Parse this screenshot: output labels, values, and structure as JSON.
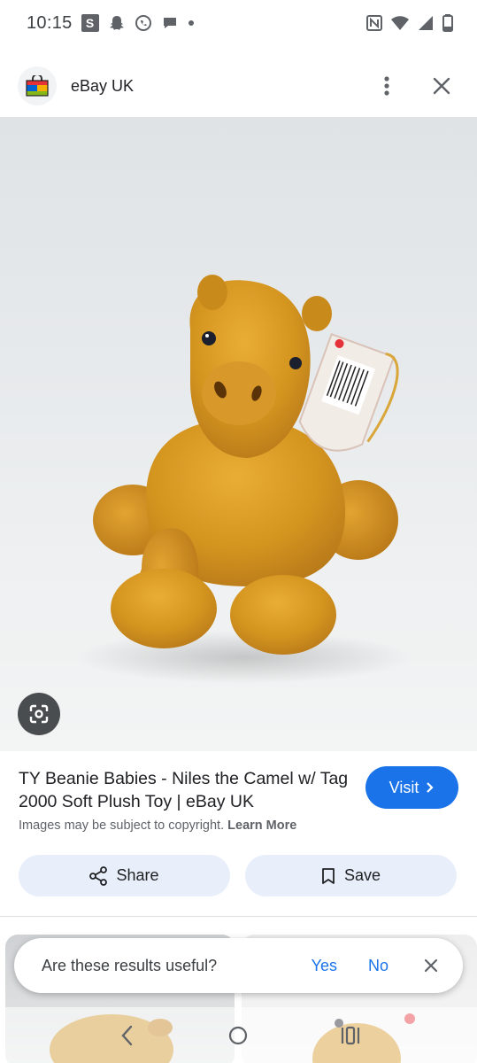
{
  "status_bar": {
    "time": "10:15",
    "s_badge": "S",
    "icons": [
      "snapchat-icon",
      "whatsapp-icon",
      "chat-bubble-icon",
      "dot-icon",
      "nfc-icon",
      "wifi-icon",
      "signal-icon",
      "battery-icon"
    ]
  },
  "header": {
    "site_name": "eBay UK",
    "icons": [
      "ebay-bag-icon",
      "more-vert-icon",
      "close-icon"
    ]
  },
  "result": {
    "title": "TY Beanie Babies - Niles the Camel w/ Tag 2000 Soft Plush Toy | eBay UK",
    "visit_label": "Visit",
    "copyright_text": "Images may be subject to copyright.",
    "learn_more": "Learn More",
    "share_label": "Share",
    "save_label": "Save"
  },
  "feedback": {
    "question": "Are these results useful?",
    "yes": "Yes",
    "no": "No"
  },
  "nav": {
    "icons": [
      "back-icon",
      "home-icon",
      "recents-icon"
    ]
  },
  "colors": {
    "accent": "#1a73e8",
    "button_bg": "#e8effa",
    "camel": "#d4951f"
  }
}
